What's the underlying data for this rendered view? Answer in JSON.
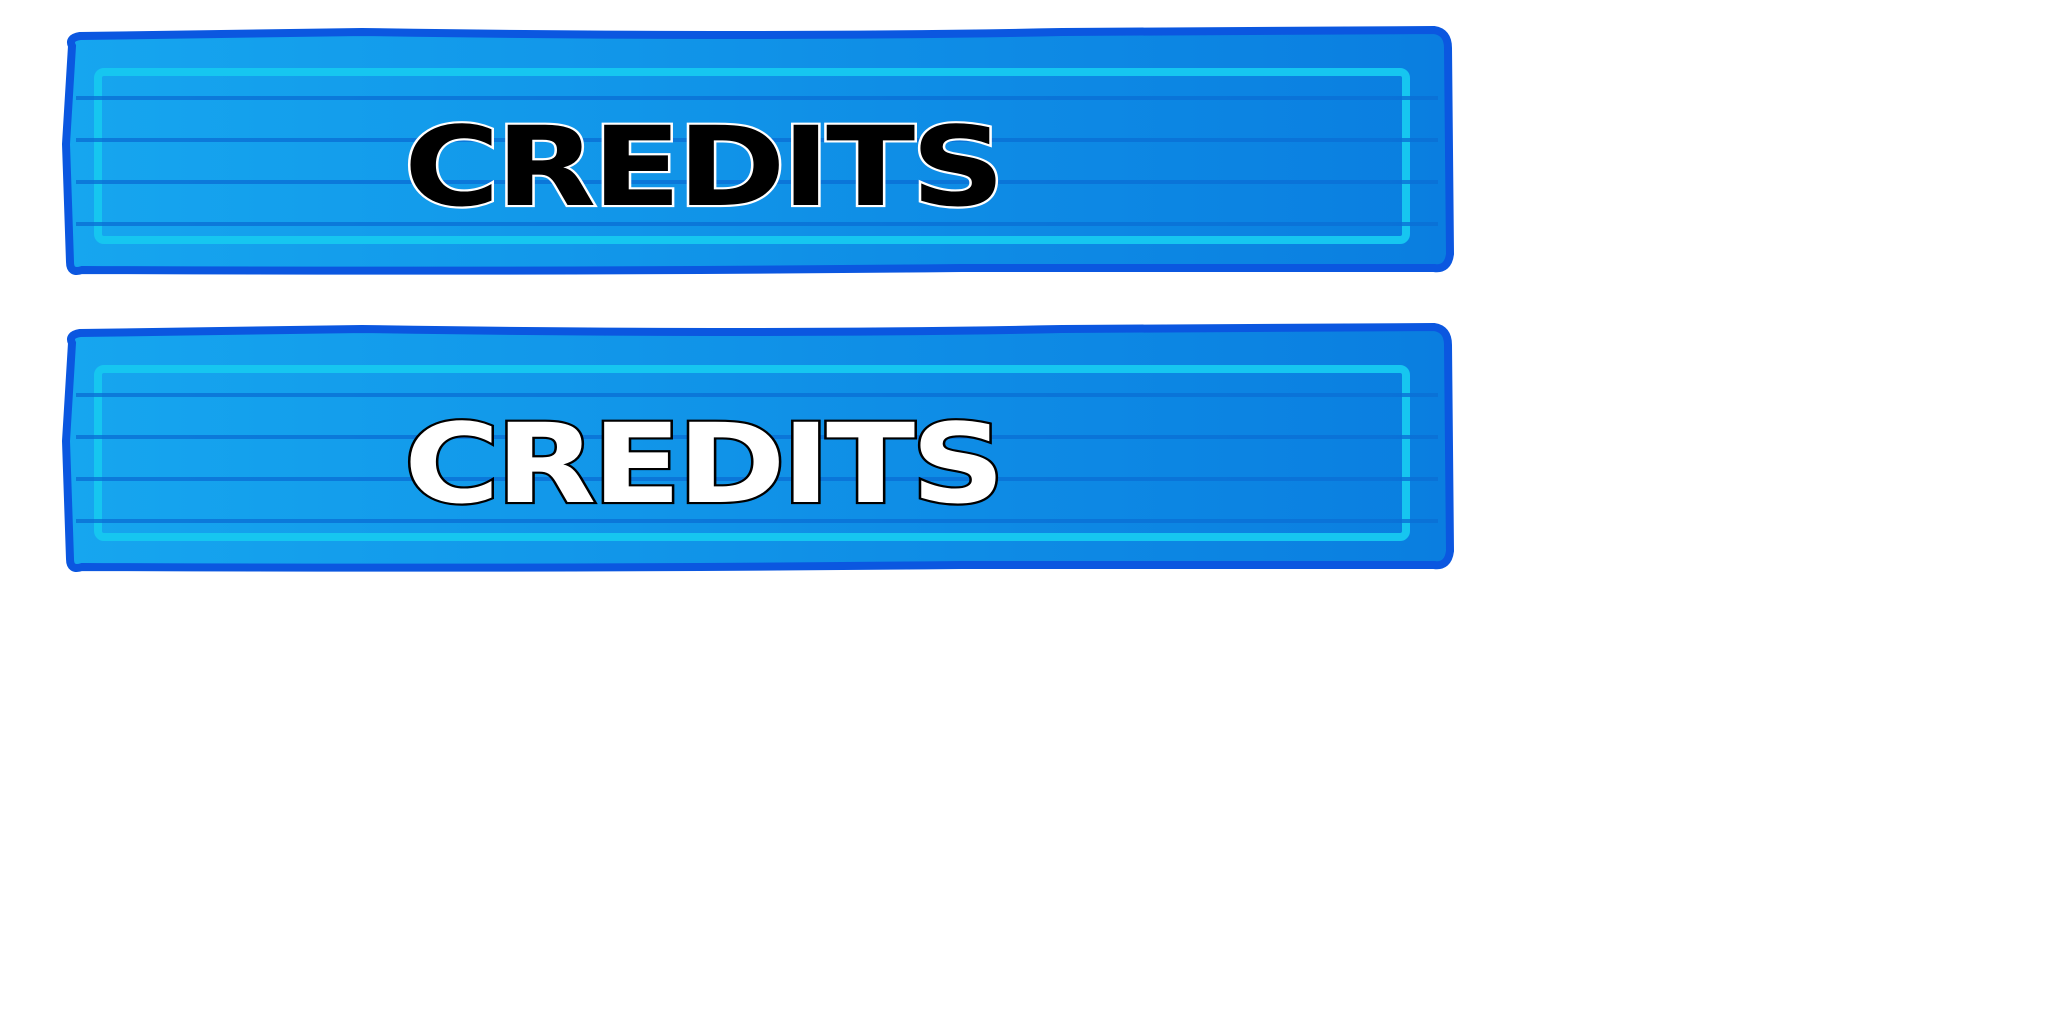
{
  "buttons": [
    {
      "label": "CREDITS",
      "state": "normal"
    },
    {
      "label": "CREDITS",
      "state": "highlighted"
    }
  ],
  "colors": {
    "button_fill_left": "#15a4ee",
    "button_fill_right": "#0a7fe0",
    "button_border": "#0b57e0",
    "button_inner_frame": "#16c6f0",
    "button_stripe": "#0a72d8"
  }
}
